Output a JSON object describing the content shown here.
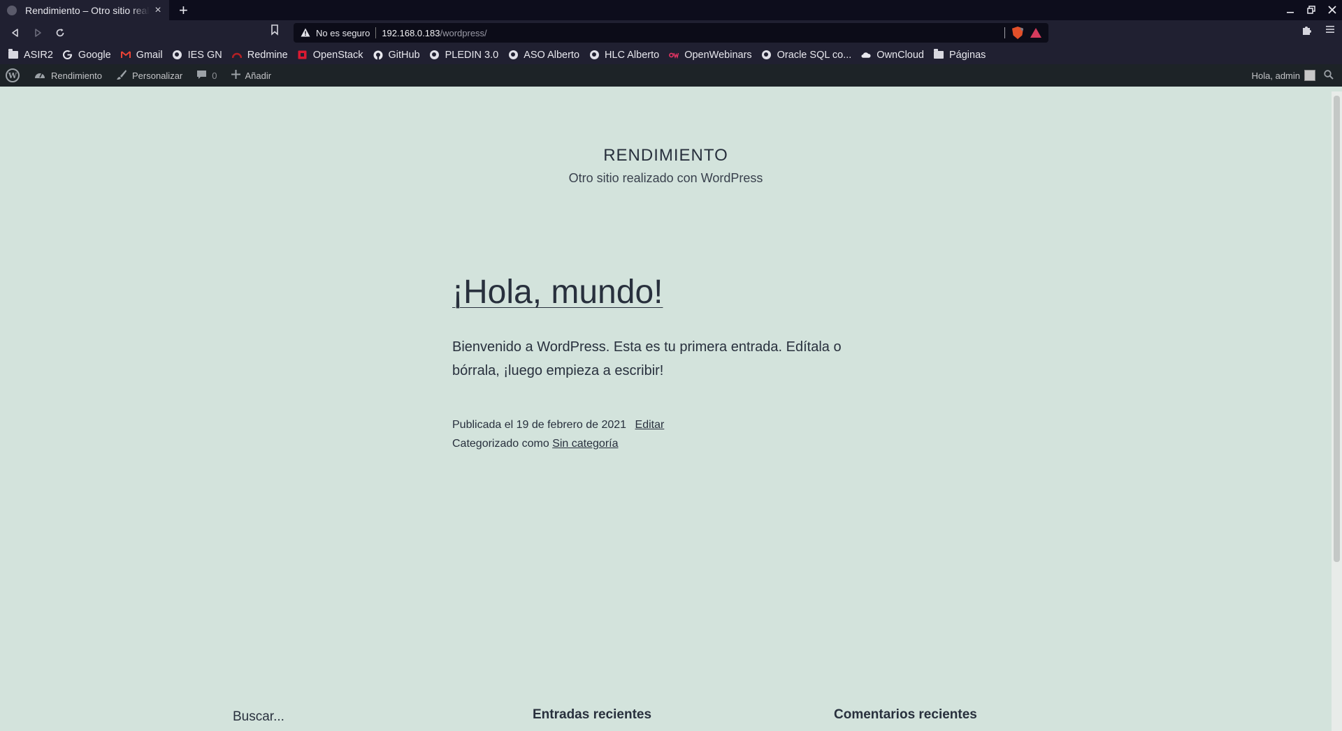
{
  "browser": {
    "tab_title": "Rendimiento – Otro sitio realizado con WordPress",
    "tab_close": "×",
    "new_tab": "+",
    "address": {
      "security_label": "No es seguro",
      "host": "192.168.0.183",
      "path": "/wordpress/",
      "shield_count": "1"
    },
    "bookmarks": [
      {
        "label": "ASIR2",
        "icon": "folder-icon"
      },
      {
        "label": "Google",
        "icon": "google-icon"
      },
      {
        "label": "Gmail",
        "icon": "gmail-icon"
      },
      {
        "label": "IES GN",
        "icon": "globe-icon"
      },
      {
        "label": "Redmine",
        "icon": "redmine-icon"
      },
      {
        "label": "OpenStack",
        "icon": "openstack-icon"
      },
      {
        "label": "GitHub",
        "icon": "github-icon"
      },
      {
        "label": "PLEDIN 3.0",
        "icon": "globe-icon"
      },
      {
        "label": "ASO Alberto",
        "icon": "globe-icon"
      },
      {
        "label": "HLC Alberto",
        "icon": "globe-icon"
      },
      {
        "label": "OpenWebinars",
        "icon": "openwebinars-icon"
      },
      {
        "label": "Oracle SQL co...",
        "icon": "globe-icon"
      },
      {
        "label": "OwnCloud",
        "icon": "cloud-icon"
      },
      {
        "label": "Páginas",
        "icon": "folder-icon"
      }
    ]
  },
  "adminbar": {
    "site_name": "Rendimiento",
    "customize": "Personalizar",
    "comments_count": "0",
    "add_new": "Añadir",
    "greeting": "Hola, admin"
  },
  "site": {
    "title": "RENDIMIENTO",
    "description": "Otro sitio realizado con WordPress"
  },
  "post": {
    "title": "¡Hola, mundo!",
    "content": "Bienvenido a WordPress. Esta es tu primera entrada. Edítala o bórrala, ¡luego empieza a escribir!",
    "published": "Publicada el 19 de febrero de 2021",
    "edit_link": "Editar",
    "categorized_prefix": "Categorizado como",
    "category": "Sin categoría"
  },
  "footer_widgets": {
    "search_placeholder": "Buscar...",
    "recent_posts": "Entradas recientes",
    "recent_comments": "Comentarios recientes"
  },
  "colors": {
    "page_background": "#d3e3dc",
    "text": "#28303d",
    "adminbar": "#1d2327",
    "browser_chrome": "#202031"
  }
}
